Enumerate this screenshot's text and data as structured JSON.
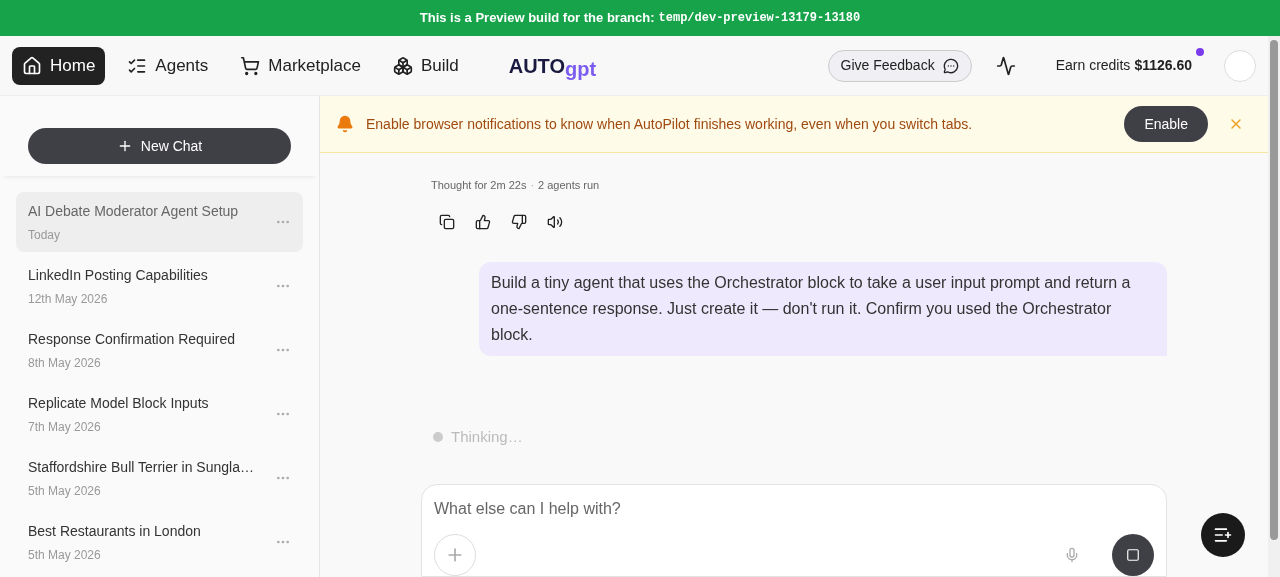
{
  "preview_banner": {
    "text": "This is a Preview build for the branch:",
    "branch": "temp/dev-preview-13179-13180"
  },
  "nav": {
    "items": [
      {
        "label": "Home",
        "selected": true
      },
      {
        "label": "Agents",
        "selected": false
      },
      {
        "label": "Marketplace",
        "selected": false
      },
      {
        "label": "Build",
        "selected": false
      }
    ],
    "logo": {
      "part_1": "AUTO",
      "part_2": "gpt"
    },
    "feedback_button": "Give Feedback",
    "credits": {
      "label": "Earn credits",
      "amount": "$1126.60",
      "unread": true
    }
  },
  "sidebar": {
    "new_chat": "New Chat",
    "chats": [
      {
        "title": "AI Debate Moderator Agent Setup",
        "date": "Today",
        "selected": true
      },
      {
        "title": "LinkedIn Posting Capabilities",
        "date": "12th May 2026",
        "selected": false
      },
      {
        "title": "Response Confirmation Required",
        "date": "8th May 2026",
        "selected": false
      },
      {
        "title": "Replicate Model Block Inputs",
        "date": "7th May 2026",
        "selected": false
      },
      {
        "title": "Staffordshire Bull Terrier in Sungla…",
        "date": "5th May 2026",
        "selected": false
      },
      {
        "title": "Best Restaurants in London",
        "date": "5th May 2026",
        "selected": false
      }
    ]
  },
  "notification": {
    "text": "Enable browser notifications to know when AutoPilot finishes working, even when you switch tabs.",
    "button": "Enable"
  },
  "chat": {
    "meta": {
      "thought": "Thought for 2m 22s",
      "separator": "·",
      "agents": "2 agents run"
    },
    "user_message": "Build a tiny agent that uses the Orchestrator block to take a user input prompt and return a one-sentence response. Just create it — don't run it. Confirm you used the Orchestrator block.",
    "status": "Thinking…"
  },
  "composer": {
    "placeholder": "What else can I help with?"
  }
}
